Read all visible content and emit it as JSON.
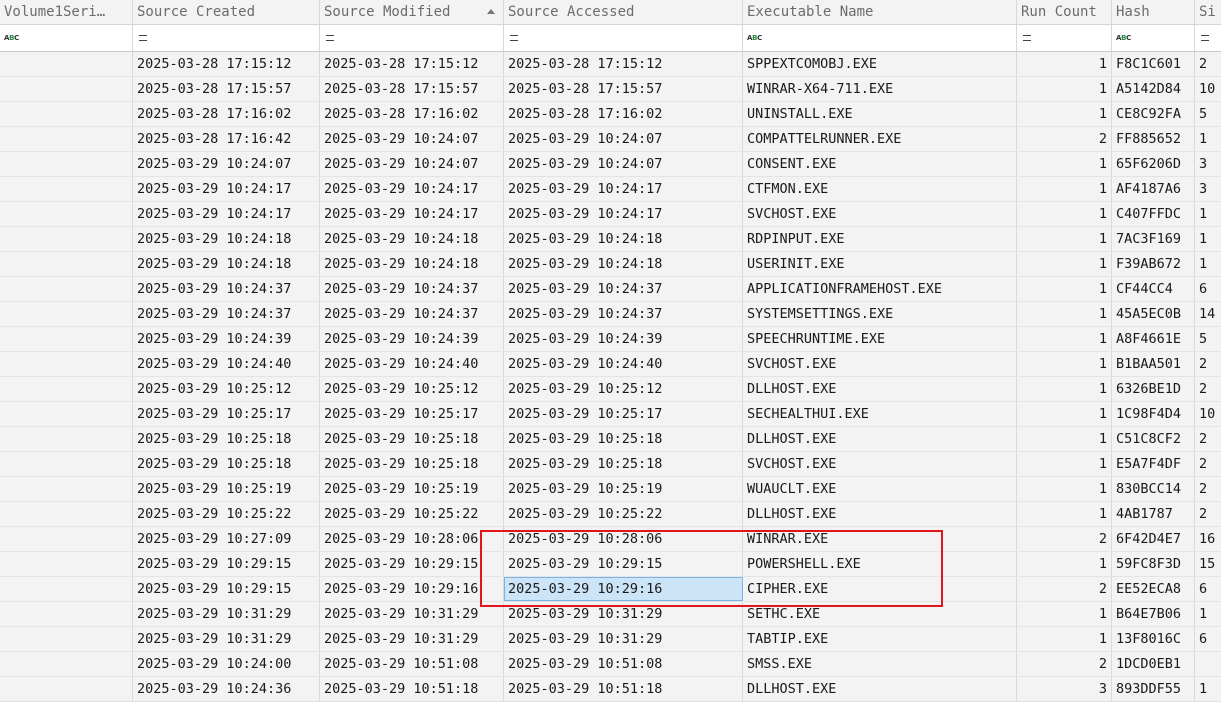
{
  "columns": [
    {
      "label": "Volume1Seri…",
      "filter": "abc"
    },
    {
      "label": "Source Created",
      "filter": "eq"
    },
    {
      "label": "Source Modified",
      "filter": "eq",
      "sorted": "asc"
    },
    {
      "label": "Source Accessed",
      "filter": "eq"
    },
    {
      "label": "Executable Name",
      "filter": "abc"
    },
    {
      "label": "Run Count",
      "filter": "eq"
    },
    {
      "label": "Hash",
      "filter": "abc"
    },
    {
      "label": "Si",
      "filter": "eq"
    }
  ],
  "rows": [
    {
      "vol": "",
      "created": "2025-03-28 17:15:12",
      "modified": "2025-03-28 17:15:12",
      "accessed": "2025-03-28 17:15:12",
      "exe": "SPPEXTCOMOBJ.EXE",
      "runs": "1",
      "hash": "F8C1C601",
      "size": "2"
    },
    {
      "vol": "",
      "created": "2025-03-28 17:15:57",
      "modified": "2025-03-28 17:15:57",
      "accessed": "2025-03-28 17:15:57",
      "exe": "WINRAR-X64-711.EXE",
      "runs": "1",
      "hash": "A5142D84",
      "size": "10"
    },
    {
      "vol": "",
      "created": "2025-03-28 17:16:02",
      "modified": "2025-03-28 17:16:02",
      "accessed": "2025-03-28 17:16:02",
      "exe": "UNINSTALL.EXE",
      "runs": "1",
      "hash": "CE8C92FA",
      "size": "5"
    },
    {
      "vol": "",
      "created": "2025-03-28 17:16:42",
      "modified": "2025-03-29 10:24:07",
      "accessed": "2025-03-29 10:24:07",
      "exe": "COMPATTELRUNNER.EXE",
      "runs": "2",
      "hash": "FF885652",
      "size": "1"
    },
    {
      "vol": "",
      "created": "2025-03-29 10:24:07",
      "modified": "2025-03-29 10:24:07",
      "accessed": "2025-03-29 10:24:07",
      "exe": "CONSENT.EXE",
      "runs": "1",
      "hash": "65F6206D",
      "size": "3"
    },
    {
      "vol": "",
      "created": "2025-03-29 10:24:17",
      "modified": "2025-03-29 10:24:17",
      "accessed": "2025-03-29 10:24:17",
      "exe": "CTFMON.EXE",
      "runs": "1",
      "hash": "AF4187A6",
      "size": "3"
    },
    {
      "vol": "",
      "created": "2025-03-29 10:24:17",
      "modified": "2025-03-29 10:24:17",
      "accessed": "2025-03-29 10:24:17",
      "exe": "SVCHOST.EXE",
      "runs": "1",
      "hash": "C407FFDC",
      "size": "1"
    },
    {
      "vol": "",
      "created": "2025-03-29 10:24:18",
      "modified": "2025-03-29 10:24:18",
      "accessed": "2025-03-29 10:24:18",
      "exe": "RDPINPUT.EXE",
      "runs": "1",
      "hash": "7AC3F169",
      "size": "1"
    },
    {
      "vol": "",
      "created": "2025-03-29 10:24:18",
      "modified": "2025-03-29 10:24:18",
      "accessed": "2025-03-29 10:24:18",
      "exe": "USERINIT.EXE",
      "runs": "1",
      "hash": "F39AB672",
      "size": "1"
    },
    {
      "vol": "",
      "created": "2025-03-29 10:24:37",
      "modified": "2025-03-29 10:24:37",
      "accessed": "2025-03-29 10:24:37",
      "exe": "APPLICATIONFRAMEHOST.EXE",
      "runs": "1",
      "hash": "CF44CC4",
      "size": "6"
    },
    {
      "vol": "",
      "created": "2025-03-29 10:24:37",
      "modified": "2025-03-29 10:24:37",
      "accessed": "2025-03-29 10:24:37",
      "exe": "SYSTEMSETTINGS.EXE",
      "runs": "1",
      "hash": "45A5EC0B",
      "size": "14"
    },
    {
      "vol": "",
      "created": "2025-03-29 10:24:39",
      "modified": "2025-03-29 10:24:39",
      "accessed": "2025-03-29 10:24:39",
      "exe": "SPEECHRUNTIME.EXE",
      "runs": "1",
      "hash": "A8F4661E",
      "size": "5"
    },
    {
      "vol": "",
      "created": "2025-03-29 10:24:40",
      "modified": "2025-03-29 10:24:40",
      "accessed": "2025-03-29 10:24:40",
      "exe": "SVCHOST.EXE",
      "runs": "1",
      "hash": "B1BAA501",
      "size": "2"
    },
    {
      "vol": "",
      "created": "2025-03-29 10:25:12",
      "modified": "2025-03-29 10:25:12",
      "accessed": "2025-03-29 10:25:12",
      "exe": "DLLHOST.EXE",
      "runs": "1",
      "hash": "6326BE1D",
      "size": "2"
    },
    {
      "vol": "",
      "created": "2025-03-29 10:25:17",
      "modified": "2025-03-29 10:25:17",
      "accessed": "2025-03-29 10:25:17",
      "exe": "SECHEALTHUI.EXE",
      "runs": "1",
      "hash": "1C98F4D4",
      "size": "10"
    },
    {
      "vol": "",
      "created": "2025-03-29 10:25:18",
      "modified": "2025-03-29 10:25:18",
      "accessed": "2025-03-29 10:25:18",
      "exe": "DLLHOST.EXE",
      "runs": "1",
      "hash": "C51C8CF2",
      "size": "2"
    },
    {
      "vol": "",
      "created": "2025-03-29 10:25:18",
      "modified": "2025-03-29 10:25:18",
      "accessed": "2025-03-29 10:25:18",
      "exe": "SVCHOST.EXE",
      "runs": "1",
      "hash": "E5A7F4DF",
      "size": "2"
    },
    {
      "vol": "",
      "created": "2025-03-29 10:25:19",
      "modified": "2025-03-29 10:25:19",
      "accessed": "2025-03-29 10:25:19",
      "exe": "WUAUCLT.EXE",
      "runs": "1",
      "hash": "830BCC14",
      "size": "2"
    },
    {
      "vol": "",
      "created": "2025-03-29 10:25:22",
      "modified": "2025-03-29 10:25:22",
      "accessed": "2025-03-29 10:25:22",
      "exe": "DLLHOST.EXE",
      "runs": "1",
      "hash": "4AB1787",
      "size": "2"
    },
    {
      "vol": "",
      "created": "2025-03-29 10:27:09",
      "modified": "2025-03-29 10:28:06",
      "accessed": "2025-03-29 10:28:06",
      "exe": "WINRAR.EXE",
      "runs": "2",
      "hash": "6F42D4E7",
      "size": "16"
    },
    {
      "vol": "",
      "created": "2025-03-29 10:29:15",
      "modified": "2025-03-29 10:29:15",
      "accessed": "2025-03-29 10:29:15",
      "exe": "POWERSHELL.EXE",
      "runs": "1",
      "hash": "59FC8F3D",
      "size": "15"
    },
    {
      "vol": "",
      "created": "2025-03-29 10:29:15",
      "modified": "2025-03-29 10:29:16",
      "accessed": "2025-03-29 10:29:16",
      "exe": "CIPHER.EXE",
      "runs": "2",
      "hash": "EE52ECA8",
      "size": "6",
      "selected": "accessed"
    },
    {
      "vol": "",
      "created": "2025-03-29 10:31:29",
      "modified": "2025-03-29 10:31:29",
      "accessed": "2025-03-29 10:31:29",
      "exe": "SETHC.EXE",
      "runs": "1",
      "hash": "B64E7B06",
      "size": "1"
    },
    {
      "vol": "",
      "created": "2025-03-29 10:31:29",
      "modified": "2025-03-29 10:31:29",
      "accessed": "2025-03-29 10:31:29",
      "exe": "TABTIP.EXE",
      "runs": "1",
      "hash": "13F8016C",
      "size": "6"
    },
    {
      "vol": "",
      "created": "2025-03-29 10:24:00",
      "modified": "2025-03-29 10:51:08",
      "accessed": "2025-03-29 10:51:08",
      "exe": "SMSS.EXE",
      "runs": "2",
      "hash": "1DCD0EB1",
      "size": ""
    },
    {
      "vol": "",
      "created": "2025-03-29 10:24:36",
      "modified": "2025-03-29 10:51:18",
      "accessed": "2025-03-29 10:51:18",
      "exe": "DLLHOST.EXE",
      "runs": "3",
      "hash": "893DDF55",
      "size": "1"
    }
  ],
  "colors": {
    "highlight_box": "#e0161c",
    "selection": "#cce4f7"
  }
}
